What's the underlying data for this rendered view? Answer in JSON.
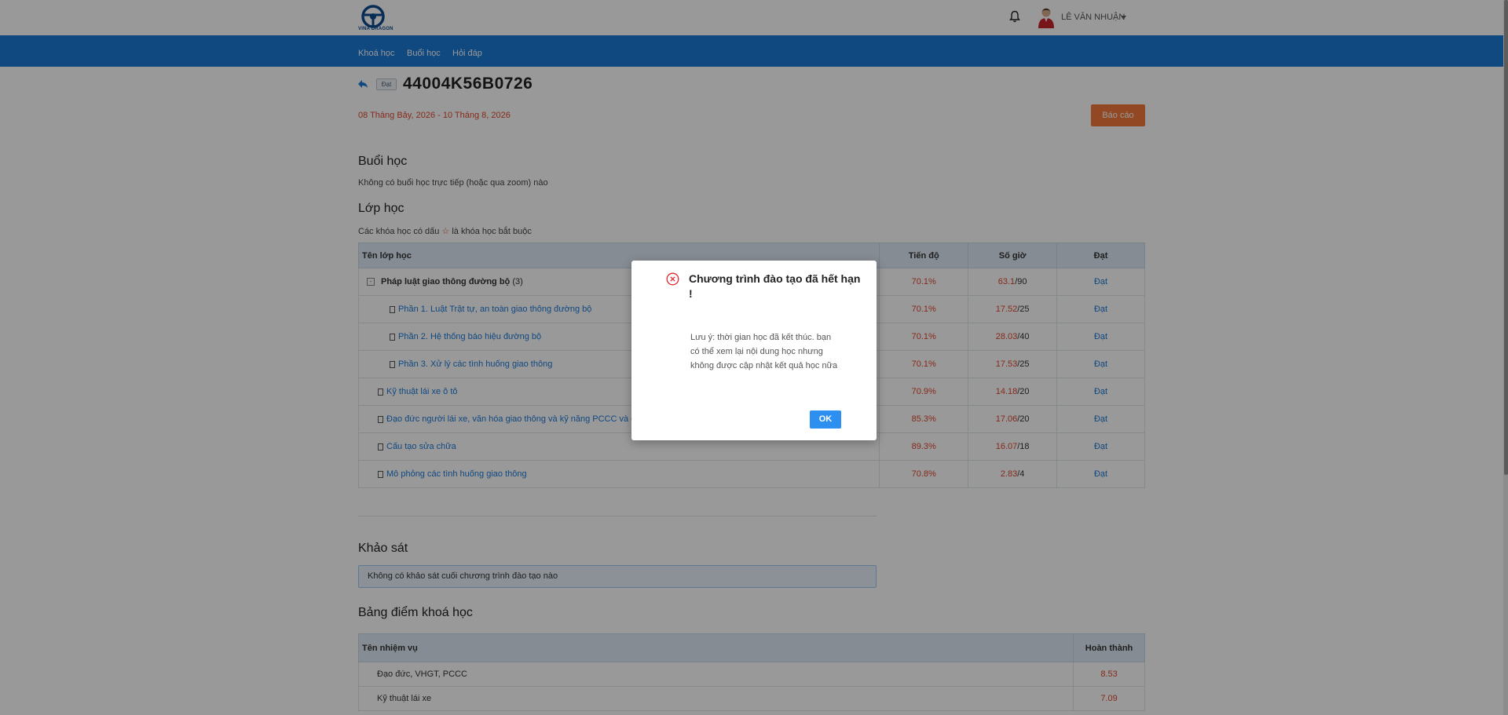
{
  "header": {
    "logo_text": "VINA DRAGON",
    "user_name": "LÊ VĂN NHUẬN"
  },
  "nav": [
    "Khoá học",
    "Buổi học",
    "Hỏi đáp"
  ],
  "course": {
    "status_badge": "Đạt",
    "code": "44004K56B0726",
    "date_range": "08 Tháng Bảy, 2026 - 10 Tháng 8, 2026",
    "report_button": "Báo cáo"
  },
  "sessions": {
    "heading": "Buổi học",
    "empty_text": "Không có buổi học trực tiếp (hoặc qua zoom) nào"
  },
  "classes": {
    "heading": "Lớp học",
    "note_before": "Các khóa học có dấu",
    "note_after": "là khóa học bắt buộc",
    "columns": [
      "Tên lớp học",
      "Tiến độ",
      "Số giờ",
      "Đạt"
    ],
    "rows": [
      {
        "name": "Pháp luật giao thông đường bộ",
        "count": "(3)",
        "progress": "70.1%",
        "hours": "63.1",
        "total": "/90",
        "pass": "Đạt"
      },
      {
        "name": "Phần 1. Luật Trật tự, an toàn giao thông đường bộ",
        "progress": "70.1%",
        "hours": "17.52",
        "total": "/25",
        "pass": "Đạt"
      },
      {
        "name": "Phần 2. Hệ thống báo hiệu đường bộ",
        "progress": "70.1%",
        "hours": "28.03",
        "total": "/40",
        "pass": "Đạt"
      },
      {
        "name": "Phần 3. Xử lý các tình huống giao thông",
        "progress": "70.1%",
        "hours": "17.53",
        "total": "/25",
        "pass": "Đạt"
      },
      {
        "name": "Kỹ thuật lái xe ô tô",
        "progress": "70.9%",
        "hours": "14.18",
        "total": "/20",
        "pass": "Đạt"
      },
      {
        "name": "Đạo đức người lái xe, văn hóa giao thông và kỹ năng PCCC và c",
        "progress": "85.3%",
        "hours": "17.06",
        "total": "/20",
        "pass": "Đạt"
      },
      {
        "name": "Cấu tạo sửa chữa",
        "progress": "89.3%",
        "hours": "16.07",
        "total": "/18",
        "pass": "Đạt"
      },
      {
        "name": "Mô phỏng các tình huống giao thông",
        "progress": "70.8%",
        "hours": "2.83",
        "total": "/4",
        "pass": "Đạt"
      }
    ]
  },
  "survey": {
    "heading": "Khảo sát",
    "empty_text": "Không có khảo sát cuối chương trình đào tạo nào"
  },
  "scores": {
    "heading": "Bảng điểm khoá học",
    "columns": [
      "Tên nhiệm vụ",
      "Hoàn thành"
    ],
    "rows": [
      {
        "name": "Đạo đức, VHGT, PCCC",
        "score": "8.53"
      },
      {
        "name": "Kỹ thuật lái xe",
        "score": "7.09"
      }
    ]
  },
  "modal": {
    "title": "Chương trình đào tạo đã hết hạn !",
    "body": "Lưu ý: thời gian học đã kết thúc. bạn có thể xem lại nội dung học nhưng không được cập nhật kết quả học nữa",
    "ok": "OK"
  }
}
